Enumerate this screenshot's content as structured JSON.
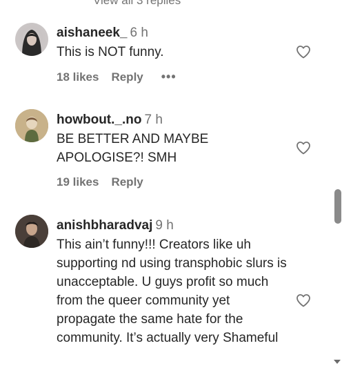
{
  "top_partial_text": "View all 3 replies",
  "comments": [
    {
      "username": "aishaneek_",
      "time": "6 h",
      "text": "This is NOT funny.",
      "likes": "18 likes",
      "reply": "Reply",
      "more": "•••",
      "avatar_icon": "profile-photo-avatar",
      "like_icon": "heart-outline-icon"
    },
    {
      "username": "howbout._.no",
      "time": "7 h",
      "text": "BE BETTER AND MAYBE APOLOGISE?! SMH",
      "likes": "19 likes",
      "reply": "Reply",
      "avatar_icon": "profile-photo-avatar",
      "like_icon": "heart-outline-icon"
    },
    {
      "username": "anishbharadvaj",
      "time": "9 h",
      "text": "This ain’t funny!!! Creators like uh supporting nd using transphobic slurs is unacceptable. U guys profit so much from the queer community yet propagate the same hate for the community. It’s actually very Shameful",
      "avatar_icon": "profile-photo-avatar",
      "like_icon": "heart-outline-icon"
    }
  ],
  "colors": {
    "text": "#262626",
    "muted": "#737373",
    "background": "#ffffff"
  }
}
